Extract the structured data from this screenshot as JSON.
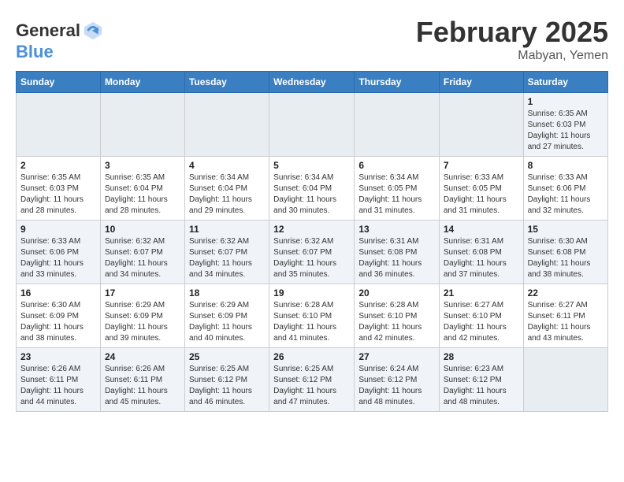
{
  "header": {
    "logo_general": "General",
    "logo_blue": "Blue",
    "month_title": "February 2025",
    "location": "Mabyan, Yemen"
  },
  "days_of_week": [
    "Sunday",
    "Monday",
    "Tuesday",
    "Wednesday",
    "Thursday",
    "Friday",
    "Saturday"
  ],
  "weeks": [
    [
      {
        "day": "",
        "info": ""
      },
      {
        "day": "",
        "info": ""
      },
      {
        "day": "",
        "info": ""
      },
      {
        "day": "",
        "info": ""
      },
      {
        "day": "",
        "info": ""
      },
      {
        "day": "",
        "info": ""
      },
      {
        "day": "1",
        "info": "Sunrise: 6:35 AM\nSunset: 6:03 PM\nDaylight: 11 hours\nand 27 minutes."
      }
    ],
    [
      {
        "day": "2",
        "info": "Sunrise: 6:35 AM\nSunset: 6:03 PM\nDaylight: 11 hours\nand 28 minutes."
      },
      {
        "day": "3",
        "info": "Sunrise: 6:35 AM\nSunset: 6:04 PM\nDaylight: 11 hours\nand 28 minutes."
      },
      {
        "day": "4",
        "info": "Sunrise: 6:34 AM\nSunset: 6:04 PM\nDaylight: 11 hours\nand 29 minutes."
      },
      {
        "day": "5",
        "info": "Sunrise: 6:34 AM\nSunset: 6:04 PM\nDaylight: 11 hours\nand 30 minutes."
      },
      {
        "day": "6",
        "info": "Sunrise: 6:34 AM\nSunset: 6:05 PM\nDaylight: 11 hours\nand 31 minutes."
      },
      {
        "day": "7",
        "info": "Sunrise: 6:33 AM\nSunset: 6:05 PM\nDaylight: 11 hours\nand 31 minutes."
      },
      {
        "day": "8",
        "info": "Sunrise: 6:33 AM\nSunset: 6:06 PM\nDaylight: 11 hours\nand 32 minutes."
      }
    ],
    [
      {
        "day": "9",
        "info": "Sunrise: 6:33 AM\nSunset: 6:06 PM\nDaylight: 11 hours\nand 33 minutes."
      },
      {
        "day": "10",
        "info": "Sunrise: 6:32 AM\nSunset: 6:07 PM\nDaylight: 11 hours\nand 34 minutes."
      },
      {
        "day": "11",
        "info": "Sunrise: 6:32 AM\nSunset: 6:07 PM\nDaylight: 11 hours\nand 34 minutes."
      },
      {
        "day": "12",
        "info": "Sunrise: 6:32 AM\nSunset: 6:07 PM\nDaylight: 11 hours\nand 35 minutes."
      },
      {
        "day": "13",
        "info": "Sunrise: 6:31 AM\nSunset: 6:08 PM\nDaylight: 11 hours\nand 36 minutes."
      },
      {
        "day": "14",
        "info": "Sunrise: 6:31 AM\nSunset: 6:08 PM\nDaylight: 11 hours\nand 37 minutes."
      },
      {
        "day": "15",
        "info": "Sunrise: 6:30 AM\nSunset: 6:08 PM\nDaylight: 11 hours\nand 38 minutes."
      }
    ],
    [
      {
        "day": "16",
        "info": "Sunrise: 6:30 AM\nSunset: 6:09 PM\nDaylight: 11 hours\nand 38 minutes."
      },
      {
        "day": "17",
        "info": "Sunrise: 6:29 AM\nSunset: 6:09 PM\nDaylight: 11 hours\nand 39 minutes."
      },
      {
        "day": "18",
        "info": "Sunrise: 6:29 AM\nSunset: 6:09 PM\nDaylight: 11 hours\nand 40 minutes."
      },
      {
        "day": "19",
        "info": "Sunrise: 6:28 AM\nSunset: 6:10 PM\nDaylight: 11 hours\nand 41 minutes."
      },
      {
        "day": "20",
        "info": "Sunrise: 6:28 AM\nSunset: 6:10 PM\nDaylight: 11 hours\nand 42 minutes."
      },
      {
        "day": "21",
        "info": "Sunrise: 6:27 AM\nSunset: 6:10 PM\nDaylight: 11 hours\nand 42 minutes."
      },
      {
        "day": "22",
        "info": "Sunrise: 6:27 AM\nSunset: 6:11 PM\nDaylight: 11 hours\nand 43 minutes."
      }
    ],
    [
      {
        "day": "23",
        "info": "Sunrise: 6:26 AM\nSunset: 6:11 PM\nDaylight: 11 hours\nand 44 minutes."
      },
      {
        "day": "24",
        "info": "Sunrise: 6:26 AM\nSunset: 6:11 PM\nDaylight: 11 hours\nand 45 minutes."
      },
      {
        "day": "25",
        "info": "Sunrise: 6:25 AM\nSunset: 6:12 PM\nDaylight: 11 hours\nand 46 minutes."
      },
      {
        "day": "26",
        "info": "Sunrise: 6:25 AM\nSunset: 6:12 PM\nDaylight: 11 hours\nand 47 minutes."
      },
      {
        "day": "27",
        "info": "Sunrise: 6:24 AM\nSunset: 6:12 PM\nDaylight: 11 hours\nand 48 minutes."
      },
      {
        "day": "28",
        "info": "Sunrise: 6:23 AM\nSunset: 6:12 PM\nDaylight: 11 hours\nand 48 minutes."
      },
      {
        "day": "",
        "info": ""
      }
    ]
  ]
}
